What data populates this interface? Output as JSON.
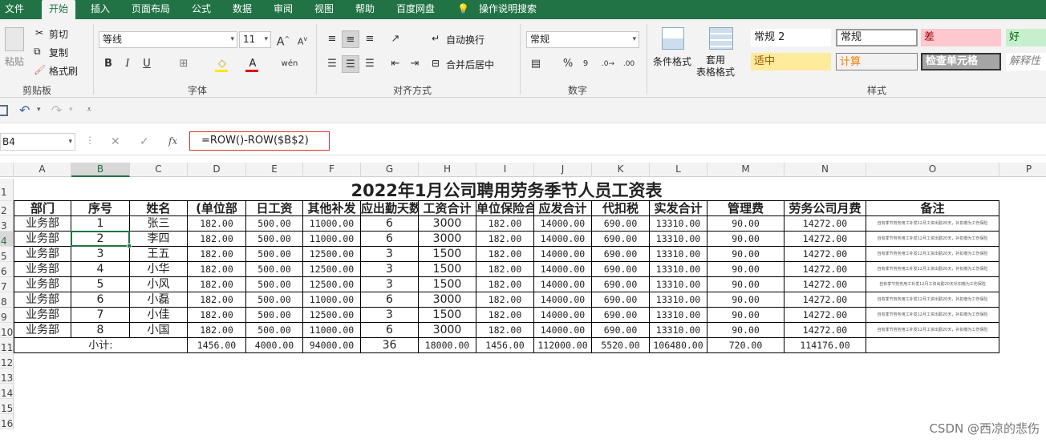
{
  "menu": [
    "文件",
    "开始",
    "插入",
    "页面布局",
    "公式",
    "数据",
    "审阅",
    "视图",
    "帮助",
    "百度网盘",
    "操作说明搜索"
  ],
  "ribbon": {
    "clipboard": {
      "group": "剪贴板",
      "paste": "粘贴",
      "cut": "剪切",
      "copy": "复制",
      "format_painter": "格式刷"
    },
    "font": {
      "group": "字体",
      "name": "等线",
      "size": "11",
      "bold": "B",
      "italic": "I",
      "underline": "U"
    },
    "alignment": {
      "group": "对齐方式",
      "wrap": "自动换行",
      "merge": "合并后居中"
    },
    "number": {
      "group": "数字",
      "format": "常规",
      "percent": "%",
      "comma": "9"
    },
    "styles": {
      "group": "样式",
      "conditional": "条件格式",
      "table_format": "套用\n表格格式",
      "cells": [
        {
          "label": "常规 2",
          "bg": "#ffffff",
          "fg": "#222222"
        },
        {
          "label": "常规",
          "bg": "#ffffff",
          "fg": "#222222"
        },
        {
          "label": "差",
          "bg": "#ffc7ce",
          "fg": "#9c0006"
        },
        {
          "label": "好",
          "bg": "#c6efce",
          "fg": "#006100"
        },
        {
          "label": "适中",
          "bg": "#ffeb9c",
          "fg": "#9c5700"
        },
        {
          "label": "计算",
          "bg": "#f2f2f2",
          "fg": "#fa7d00"
        },
        {
          "label": "检查单元格",
          "bg": "#a5a5a5",
          "fg": "#ffffff"
        },
        {
          "label": "解释性",
          "bg": "#ffffff",
          "fg": "#7f7f7f"
        }
      ]
    }
  },
  "formula_bar": {
    "cell_ref": "B4",
    "fx": "fx",
    "formula": "=ROW()-ROW($B$2)"
  },
  "columns": [
    "A",
    "B",
    "C",
    "D",
    "E",
    "F",
    "G",
    "H",
    "I",
    "J",
    "K",
    "L",
    "M",
    "N",
    "O",
    "P"
  ],
  "rows": [
    "1",
    "2",
    "3",
    "4",
    "5",
    "6",
    "7",
    "8",
    "9",
    "10",
    "11",
    "12",
    "13",
    "14",
    "15",
    "16"
  ],
  "sheet": {
    "title": "2022年1月公司聘用劳务季节人员工资表",
    "headers": [
      "部门",
      "序号",
      "姓名",
      "(单位部",
      "日工资",
      "其他补发",
      "应出勤天数",
      "工资合计",
      "单位保险合",
      "应发合计",
      "代扣税",
      "实发合计",
      "管理费",
      "劳务公司月费",
      "备注"
    ],
    "rows": [
      [
        "业务部",
        "1",
        "张三",
        "182.00",
        "500.00",
        "11000.00",
        "6",
        "3000",
        "182.00",
        "14000.00",
        "690.00",
        "13310.00",
        "90.00",
        "14272.00",
        "自有季节劳务用工补发12月工资出勤20天，补扣缴为工伤保险"
      ],
      [
        "业务部",
        "2",
        "李四",
        "182.00",
        "500.00",
        "11000.00",
        "6",
        "3000",
        "182.00",
        "14000.00",
        "690.00",
        "13310.00",
        "90.00",
        "14272.00",
        "自有季节劳务用工补发12月工资出勤20天，补扣缴为工伤保险"
      ],
      [
        "业务部",
        "3",
        "王五",
        "182.00",
        "500.00",
        "12500.00",
        "3",
        "1500",
        "182.00",
        "14000.00",
        "690.00",
        "13310.00",
        "90.00",
        "14272.00",
        "自有季节劳务用工补发12月工资出勤20天，补扣缴为工伤保险"
      ],
      [
        "业务部",
        "4",
        "小华",
        "182.00",
        "500.00",
        "12500.00",
        "3",
        "1500",
        "182.00",
        "14000.00",
        "690.00",
        "13310.00",
        "90.00",
        "14272.00",
        "自有季节劳务用工补发12月工资出勤20天，补扣缴为工伤保险"
      ],
      [
        "业务部",
        "5",
        "小风",
        "182.00",
        "500.00",
        "12500.00",
        "3",
        "1500",
        "182.00",
        "14000.00",
        "690.00",
        "13310.00",
        "90.00",
        "14272.00",
        "自有季节劳务用工补发12月工资出勤20天补扣缴为工伤保险"
      ],
      [
        "业务部",
        "6",
        "小磊",
        "182.00",
        "500.00",
        "11000.00",
        "6",
        "3000",
        "182.00",
        "14000.00",
        "690.00",
        "13310.00",
        "90.00",
        "14272.00",
        "自有季节劳务用工补发12月工资出勤20天，补扣缴为工伤保险"
      ],
      [
        "业务部",
        "7",
        "小佳",
        "182.00",
        "500.00",
        "12500.00",
        "3",
        "1500",
        "182.00",
        "14000.00",
        "690.00",
        "13310.00",
        "90.00",
        "14272.00",
        "自有季节劳务用工补发12月工资出勤20天，补扣缴为工伤保险"
      ],
      [
        "业务部",
        "8",
        "小国",
        "182.00",
        "500.00",
        "11000.00",
        "6",
        "3000",
        "182.00",
        "14000.00",
        "690.00",
        "13310.00",
        "90.00",
        "14272.00",
        "自有季节劳务用工补发12月工资出勤20天，补扣缴为工伤保险"
      ]
    ],
    "subtotal": {
      "label": "小计:",
      "values": [
        "1456.00",
        "4000.00",
        "94000.00",
        "36",
        "18000.00",
        "1456.00",
        "112000.00",
        "5520.00",
        "106480.00",
        "720.00",
        "114176.00",
        ""
      ]
    }
  },
  "watermark": "CSDN @西凉的悲伤"
}
